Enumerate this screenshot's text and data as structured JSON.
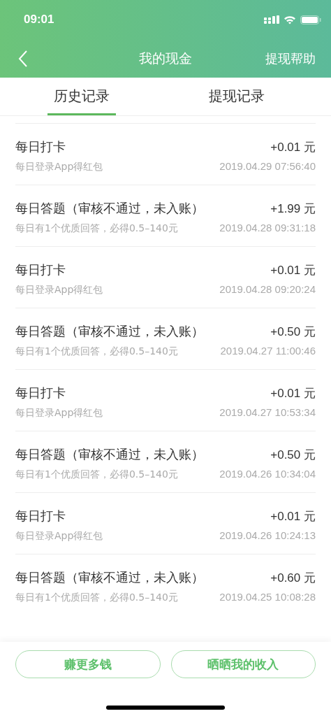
{
  "status_bar": {
    "time": "09:01"
  },
  "nav": {
    "title": "我的现金",
    "action": "提现帮助"
  },
  "tabs": [
    {
      "label": "历史记录",
      "selected": true
    },
    {
      "label": "提现记录",
      "selected": false
    }
  ],
  "records": [
    {
      "title": "每日打卡",
      "amount": "+0.01 元",
      "note": "每日登录App得红包",
      "time": "2019.04.29 07:56:40"
    },
    {
      "title": "每日答题（审核不通过，未入账）",
      "amount": "+1.99 元",
      "note": "每日有1个优质回答，必得0.5–140元",
      "time": "2019.04.28 09:31:18"
    },
    {
      "title": "每日打卡",
      "amount": "+0.01 元",
      "note": "每日登录App得红包",
      "time": "2019.04.28 09:20:24"
    },
    {
      "title": "每日答题（审核不通过，未入账）",
      "amount": "+0.50 元",
      "note": "每日有1个优质回答，必得0.5–140元",
      "time": "2019.04.27 11:00:46"
    },
    {
      "title": "每日打卡",
      "amount": "+0.01 元",
      "note": "每日登录App得红包",
      "time": "2019.04.27 10:53:34"
    },
    {
      "title": "每日答题（审核不通过，未入账）",
      "amount": "+0.50 元",
      "note": "每日有1个优质回答，必得0.5–140元",
      "time": "2019.04.26 10:34:04"
    },
    {
      "title": "每日打卡",
      "amount": "+0.01 元",
      "note": "每日登录App得红包",
      "time": "2019.04.26 10:24:13"
    },
    {
      "title": "每日答题（审核不通过，未入账）",
      "amount": "+0.60 元",
      "note": "每日有1个优质回答，必得0.5–140元",
      "time": "2019.04.25 10:08:28"
    }
  ],
  "buttons": [
    "赚更多钱",
    "晒晒我的收入"
  ]
}
